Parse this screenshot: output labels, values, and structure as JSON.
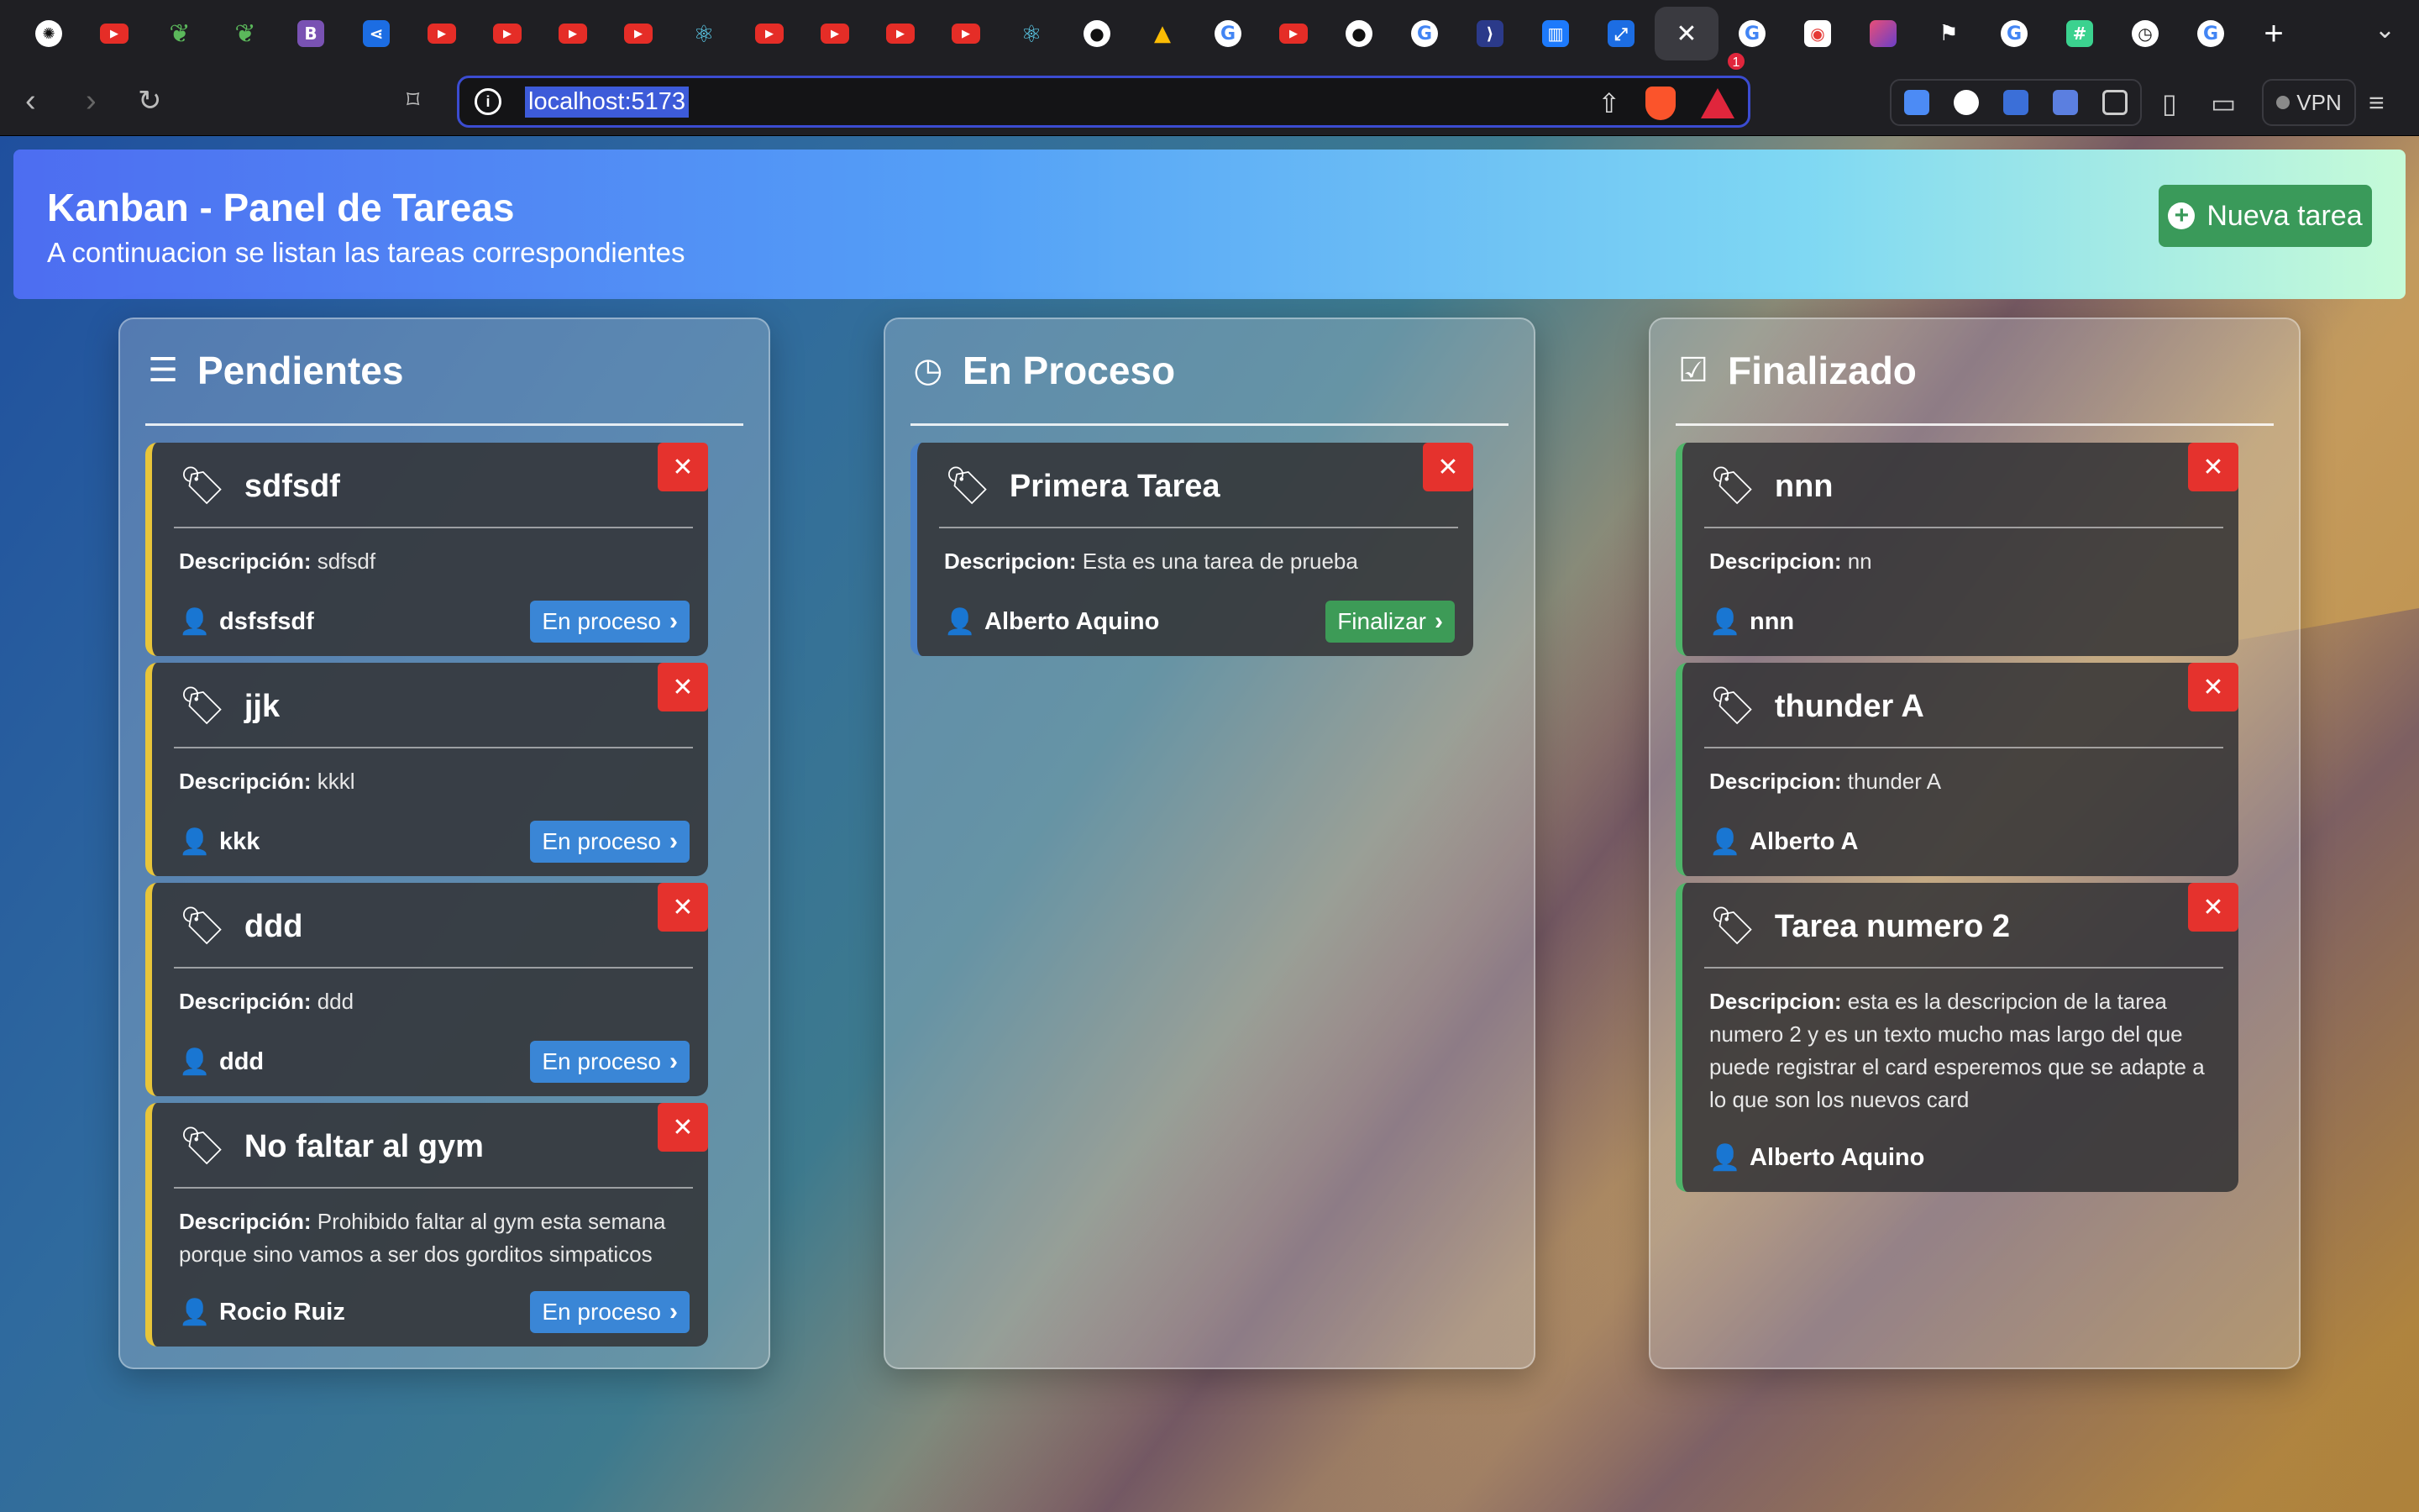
{
  "browser": {
    "tabs": [
      {
        "icon": "chatgpt-icon",
        "glyph": "✺",
        "cls": "gpt"
      },
      {
        "icon": "youtube-icon",
        "glyph": "▶",
        "cls": "yt"
      },
      {
        "icon": "leaf-icon",
        "glyph": "❦",
        "cls": "green"
      },
      {
        "icon": "leaf-icon",
        "glyph": "❦",
        "cls": "green"
      },
      {
        "icon": "bootstrap-icon",
        "glyph": "B",
        "cls": "boot"
      },
      {
        "icon": "share-icon",
        "glyph": "⋖",
        "cls": "blue"
      },
      {
        "icon": "youtube-icon",
        "glyph": "▶",
        "cls": "yt"
      },
      {
        "icon": "youtube-icon",
        "glyph": "▶",
        "cls": "yt"
      },
      {
        "icon": "youtube-icon",
        "glyph": "▶",
        "cls": "yt"
      },
      {
        "icon": "youtube-icon",
        "glyph": "▶",
        "cls": "yt"
      },
      {
        "icon": "react-icon",
        "glyph": "⚛",
        "cls": "react"
      },
      {
        "icon": "youtube-icon",
        "glyph": "▶",
        "cls": "yt"
      },
      {
        "icon": "youtube-icon",
        "glyph": "▶",
        "cls": "yt"
      },
      {
        "icon": "youtube-icon",
        "glyph": "▶",
        "cls": "yt"
      },
      {
        "icon": "youtube-icon",
        "glyph": "▶",
        "cls": "yt"
      },
      {
        "icon": "react-icon",
        "glyph": "⚛",
        "cls": "react"
      },
      {
        "icon": "github-icon",
        "glyph": "●",
        "cls": "gh"
      },
      {
        "icon": "google-drive-icon",
        "glyph": "▲",
        "cls": "drive"
      },
      {
        "icon": "google-icon",
        "glyph": "G",
        "cls": "gg"
      },
      {
        "icon": "youtube-icon",
        "glyph": "▶",
        "cls": "yt"
      },
      {
        "icon": "github-icon",
        "glyph": "●",
        "cls": "gh"
      },
      {
        "icon": "google-icon",
        "glyph": "G",
        "cls": "gg"
      },
      {
        "icon": "vscode-icon",
        "glyph": "⟩",
        "cls": "dark"
      },
      {
        "icon": "trello-icon",
        "glyph": "▥",
        "cls": "trello"
      },
      {
        "icon": "link-icon",
        "glyph": "⤢",
        "cls": "blue"
      },
      {
        "icon": "close-icon",
        "glyph": "✕",
        "cls": "close",
        "active": true
      },
      {
        "icon": "google-icon",
        "glyph": "G",
        "cls": "gg"
      },
      {
        "icon": "record-icon",
        "glyph": "◉",
        "cls": "rec"
      },
      {
        "icon": "gradient-app-icon",
        "glyph": "",
        "cls": "purple"
      },
      {
        "icon": "flag-icon",
        "glyph": "⚑",
        "cls": "flag"
      },
      {
        "icon": "google-icon",
        "glyph": "G",
        "cls": "gg"
      },
      {
        "icon": "hash-icon",
        "glyph": "#",
        "cls": "mint"
      },
      {
        "icon": "clock-app-icon",
        "glyph": "◷",
        "cls": "white"
      },
      {
        "icon": "google-icon",
        "glyph": "G",
        "cls": "gg"
      }
    ],
    "url": "localhost:5173",
    "vpn_label": "VPN",
    "rewards_badge": "1"
  },
  "header": {
    "title": "Kanban - Panel de Tareas",
    "subtitle": "A continuacion se listan las tareas correspondientes",
    "new_task_label": "Nueva tarea"
  },
  "columns": [
    {
      "key": "pendientes",
      "title": "Pendientes",
      "icon": "list-icon",
      "accent": "#e8c53a",
      "cards": [
        {
          "title": "sdfsdf",
          "desc_label": "Descripción:",
          "desc": "sdfsdf",
          "user": "dsfsfsdf",
          "action": "En proceso"
        },
        {
          "title": "jjk",
          "desc_label": "Descripción:",
          "desc": "kkkl",
          "user": "kkk",
          "action": "En proceso"
        },
        {
          "title": "ddd",
          "desc_label": "Descripción:",
          "desc": "ddd",
          "user": "ddd",
          "action": "En proceso"
        },
        {
          "title": "No faltar al gym",
          "desc_label": "Descripción:",
          "desc": "Prohibido faltar al gym esta semana porque sino vamos a ser dos gorditos simpaticos",
          "user": "Rocio Ruiz",
          "action": "En proceso"
        }
      ]
    },
    {
      "key": "en-proceso",
      "title": "En Proceso",
      "icon": "clock-icon",
      "accent": "#4a82c9",
      "cards": [
        {
          "title": "Primera Tarea",
          "desc_label": "Descripcion:",
          "desc": "Esta es una tarea de prueba",
          "user": "Alberto Aquino",
          "action": "Finalizar"
        }
      ]
    },
    {
      "key": "finalizado",
      "title": "Finalizado",
      "icon": "check-square-icon",
      "accent": "#4fb469",
      "cards": [
        {
          "title": "nnn",
          "desc_label": "Descripcion:",
          "desc": "nn",
          "user": "nnn",
          "action": ""
        },
        {
          "title": "thunder A",
          "desc_label": "Descripcion:",
          "desc": "thunder A",
          "user": "Alberto A",
          "action": ""
        },
        {
          "title": "Tarea numero 2",
          "desc_label": "Descripcion:",
          "desc": "esta es la descripcion de la tarea numero 2 y es un texto mucho mas largo del que puede registrar el card esperemos que se adapte a lo que son los nuevos card",
          "user": "Alberto Aquino",
          "action": ""
        }
      ]
    }
  ]
}
